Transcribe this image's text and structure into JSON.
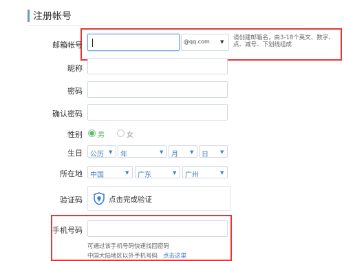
{
  "section": {
    "title": "注册帐号"
  },
  "email": {
    "label": "邮箱帐号",
    "value": "",
    "domain": "@qq.com",
    "hint": "请创建邮箱名，由3-18个英文、数字、点、减号、下划线组成"
  },
  "nickname": {
    "label": "昵称",
    "value": ""
  },
  "password": {
    "label": "密码",
    "value": ""
  },
  "confirm_password": {
    "label": "确认密码",
    "value": ""
  },
  "gender": {
    "label": "性别",
    "options": [
      "男",
      "女"
    ],
    "selected": "男"
  },
  "birthday": {
    "label": "生日",
    "calendar": "公历",
    "year": "年",
    "month": "月",
    "day": "日"
  },
  "location": {
    "label": "所在地",
    "country": "中国",
    "province": "广东",
    "city": "广州"
  },
  "captcha": {
    "label": "验证码",
    "text": "点击完成验证"
  },
  "phone": {
    "label": "手机号码",
    "value": "",
    "hint1": "可通过该手机号码快速找回密码",
    "hint2": "中国大陆地区以外手机号码",
    "link": "点击这里"
  },
  "colors": {
    "accent": "#5b9bd5",
    "highlight": "#e33636",
    "select_text": "#4a7fc1"
  },
  "icons": {
    "captcha": "shield-icon",
    "dropdown": "chevron-down-icon"
  }
}
